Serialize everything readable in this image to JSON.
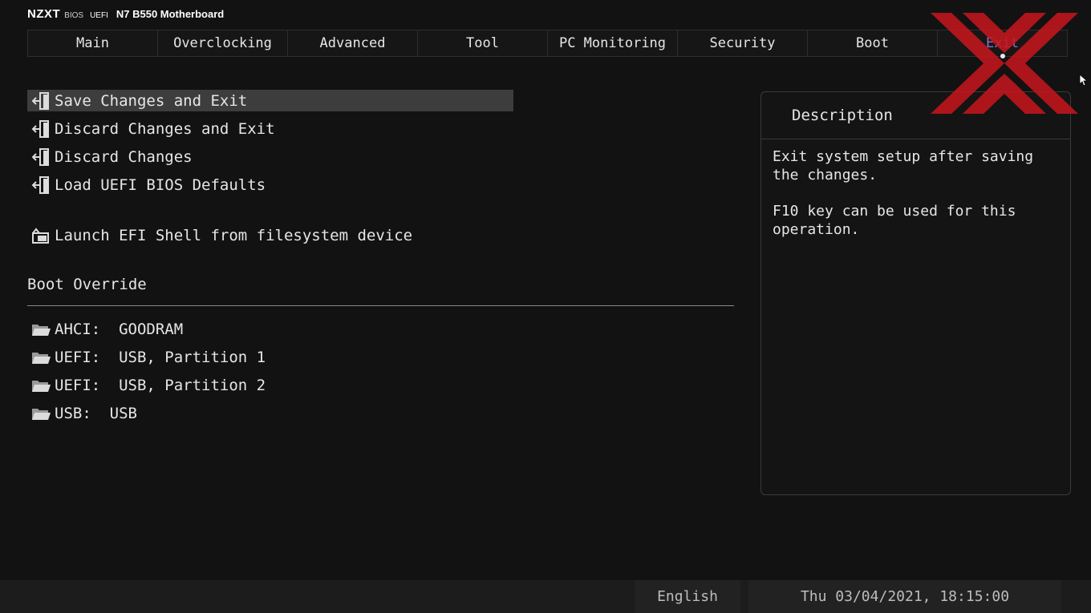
{
  "header": {
    "brand": "NZXT",
    "bios": "BIOS",
    "uefi": "UEFI",
    "model": "N7 B550 Motherboard"
  },
  "tabs": [
    {
      "label": "Main"
    },
    {
      "label": "Overclocking"
    },
    {
      "label": "Advanced"
    },
    {
      "label": "Tool"
    },
    {
      "label": "PC Monitoring"
    },
    {
      "label": "Security"
    },
    {
      "label": "Boot"
    },
    {
      "label": "Exit",
      "active": true
    }
  ],
  "menu": {
    "save_exit": "Save Changes and Exit",
    "discard_exit": "Discard Changes and Exit",
    "discard": "Discard Changes",
    "load_defaults": "Load UEFI BIOS Defaults",
    "launch_shell": "Launch EFI Shell from filesystem device"
  },
  "boot_override": {
    "title": "Boot Override",
    "items": [
      "AHCI:  GOODRAM",
      "UEFI:  USB, Partition 1",
      "UEFI:  USB, Partition 2",
      "USB:  USB"
    ]
  },
  "description": {
    "title": "Description",
    "line1": "Exit system setup after saving the changes.",
    "line2": "F10 key can be used for this operation."
  },
  "footer": {
    "language": "English",
    "datetime": "Thu 03/04/2021, 18:15:00"
  },
  "colors": {
    "accent": "#8e6fd0",
    "watermark": "#c8161d",
    "selected_bg": "#3d3d3d"
  },
  "icons": {
    "exit": "door-exit-icon",
    "shell": "launch-shell-icon",
    "boot_device": "folder-icon"
  }
}
